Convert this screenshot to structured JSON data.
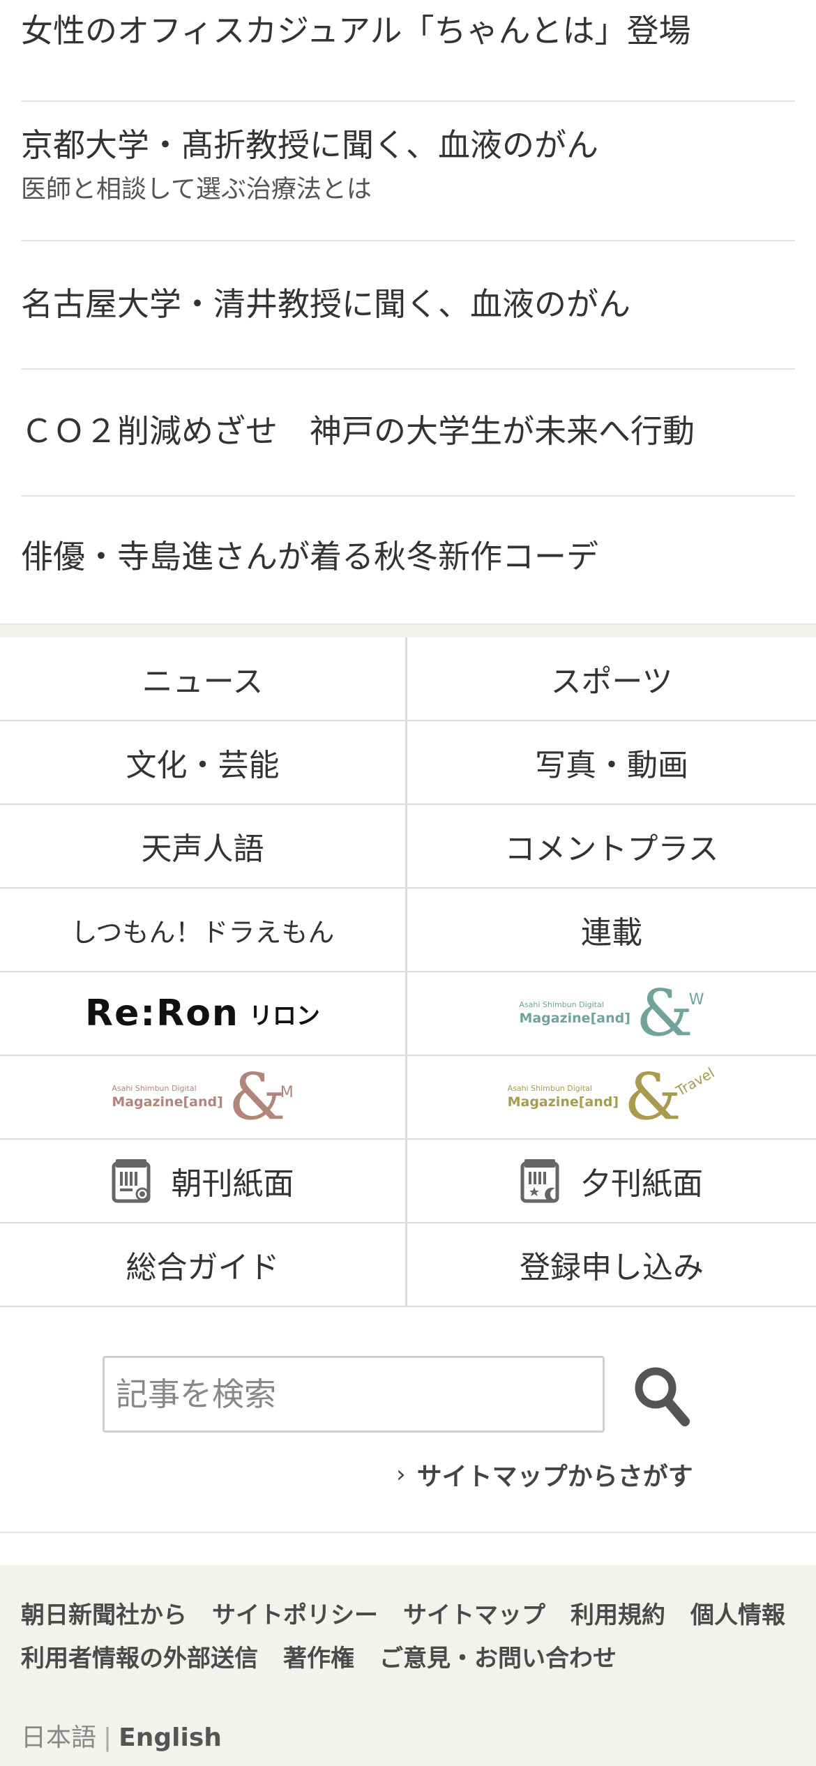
{
  "articles": [
    {
      "title": "女性のオフィスカジュアル「ちゃんとは」登場"
    },
    {
      "title": "京都大学・髙折教授に聞く、血液のがん",
      "subtitle": "医師と相談して選ぶ治療法とは"
    },
    {
      "title": "名古屋大学・清井教授に聞く、血液のがん"
    },
    {
      "title": "ＣＯ２削減めざせ　神戸の大学生が未来へ行動"
    },
    {
      "title": "俳優・寺島進さんが着る秋冬新作コーデ"
    }
  ],
  "nav": {
    "news": "ニュース",
    "sports": "スポーツ",
    "culture": "文化・芸能",
    "photo_video": "写真・動画",
    "tenseijingo": "天声人語",
    "comment_plus": "コメントプラス",
    "shitsumon": "しつもん！ドラえもん",
    "rensai": "連載",
    "reron": {
      "word": "Re:Ron",
      "kana": "リロン"
    },
    "and_w": {
      "small": "Asahi Shimbun Digital",
      "big": "Magazine[and]",
      "amp": "&",
      "suffix": "W",
      "color": "#6fa39c"
    },
    "and_m": {
      "small": "Asahi Shimbun Digital",
      "big": "Magazine[and]",
      "amp": "&",
      "suffix": "M",
      "color": "#b2857a"
    },
    "and_travel": {
      "small": "Asahi Shimbun Digital",
      "big": "Magazine[and]",
      "amp": "&",
      "suffix": "Travel",
      "color": "#a89a4e"
    },
    "morning_paper": "朝刊紙面",
    "evening_paper": "夕刊紙面",
    "guide": "総合ガイド",
    "signup": "登録申し込み"
  },
  "search": {
    "placeholder": "記事を検索",
    "sitemap_link": "サイトマップからさがす"
  },
  "footer": {
    "row1": [
      "朝日新聞社から",
      "サイトポリシー",
      "サイトマップ",
      "利用規約",
      "個人情報"
    ],
    "row2": [
      "利用者情報の外部送信",
      "著作権",
      "ご意見・お問い合わせ"
    ],
    "lang_ja": "日本語",
    "lang_sep": "|",
    "lang_en": "English"
  },
  "icons": {
    "search": "search-icon",
    "chevron": "chevron-right-icon",
    "morning": "morning-paper-icon",
    "evening": "evening-paper-icon"
  }
}
